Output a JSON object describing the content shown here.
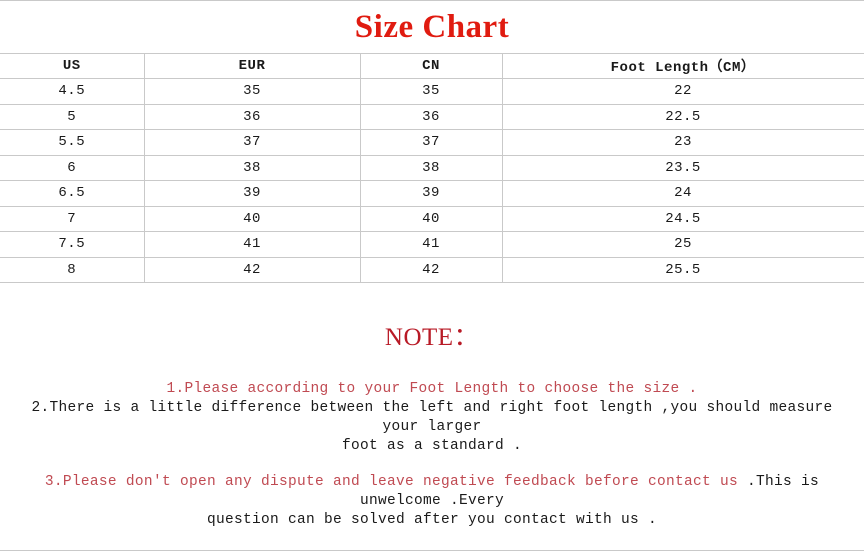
{
  "title": "Size Chart",
  "table": {
    "headers": [
      "US",
      "EUR",
      "CN",
      "Foot Length（CM）"
    ],
    "rows": [
      [
        "4.5",
        "35",
        "35",
        "22"
      ],
      [
        "5",
        "36",
        "36",
        "22.5"
      ],
      [
        "5.5",
        "37",
        "37",
        "23"
      ],
      [
        "6",
        "38",
        "38",
        "23.5"
      ],
      [
        "6.5",
        "39",
        "39",
        "24"
      ],
      [
        "7",
        "40",
        "40",
        "24.5"
      ],
      [
        "7.5",
        "41",
        "41",
        "25"
      ],
      [
        "8",
        "42",
        "42",
        "25.5"
      ]
    ]
  },
  "note": {
    "heading": "NOTE：",
    "line1": "1.Please according to your Foot Length to choose the size .",
    "line2a": "2.There is a little  difference between the left and right foot length  ,you should measure your larger",
    "line2b": "foot as a standard .",
    "line3_red": "3.Please don't open any dispute and leave negative feedback before contact us ",
    "line3_black": ".This is unwelcome .Every",
    "line3b": "question can be solved after you contact with us ."
  },
  "colors": {
    "title_red": "#e01b10",
    "note_heading_red": "#b81a26",
    "note_body_red": "#c04a52",
    "body_black": "#1a1a1a",
    "grid_line": "#c9c9c9"
  }
}
